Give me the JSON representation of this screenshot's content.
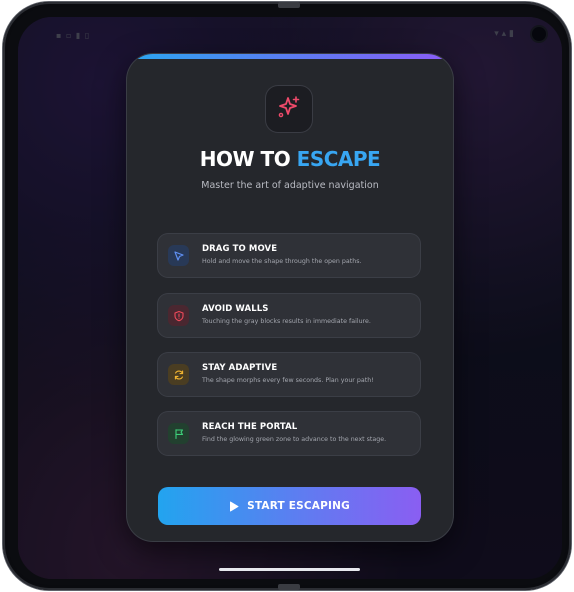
{
  "status_bar": {
    "left_icons": "▪ ▫ ▮ ▯",
    "right_icons": "▾ ▴ ▮"
  },
  "modal": {
    "title_part1": "HOW TO ",
    "title_part2": "ESCAPE",
    "subtitle": "Master the art of adaptive navigation",
    "badge_icon": "sparkles-icon",
    "rules": [
      {
        "title": "DRAG TO MOVE",
        "description": "Hold and move the shape through the open paths.",
        "icon": "cursor-pointer-icon",
        "color": "#4f7df0"
      },
      {
        "title": "AVOID WALLS",
        "description": "Touching the gray blocks results in immediate failure.",
        "icon": "shield-alert-icon",
        "color": "#ef4a5a"
      },
      {
        "title": "STAY ADAPTIVE",
        "description": "The shape morphs every few seconds. Plan your path!",
        "icon": "refresh-icon",
        "color": "#f2b531"
      },
      {
        "title": "REACH THE PORTAL",
        "description": "Find the glowing green zone to advance to the next stage.",
        "icon": "flag-icon",
        "color": "#3ed07a"
      }
    ],
    "start_button": {
      "label": "START ESCAPING",
      "icon": "play-icon"
    }
  },
  "colors": {
    "accent_blue": "#38a6f2",
    "accent_purple": "#8b5cf6",
    "badge_pink": "#ef4a6a",
    "modal_bg": "#25272c"
  }
}
